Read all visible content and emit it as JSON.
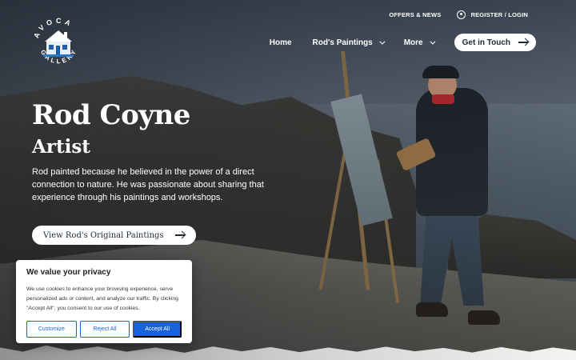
{
  "logo": {
    "line1": "AVOCA",
    "line2": "GALLERY"
  },
  "top_links": {
    "offers": "OFFERS & NEWS",
    "register": "REGISTER / LOGIN"
  },
  "nav": {
    "home": "Home",
    "paintings": "Rod's Paintings",
    "more": "More",
    "cta": "Get in Touch"
  },
  "hero": {
    "title": "Rod Coyne",
    "subtitle": "Artist",
    "description": "Rod painted because he believed in the power of a direct connection to nature. He was passionate about sharing that experience through his paintings and workshops.",
    "button": "View Rod's Original Paintings"
  },
  "cookie": {
    "title": "We value your privacy",
    "text": "We use cookies to enhance your browsing experience, serve personalized ads or content, and analyze our traffic. By clicking \"Accept All\", you consent to our use of cookies.",
    "customize": "Customize",
    "reject": "Reject All",
    "accept": "Accept All"
  },
  "colors": {
    "accent_blue": "#1863dc",
    "text_dark": "#1e2a36",
    "scarf_red": "#b2282c"
  }
}
